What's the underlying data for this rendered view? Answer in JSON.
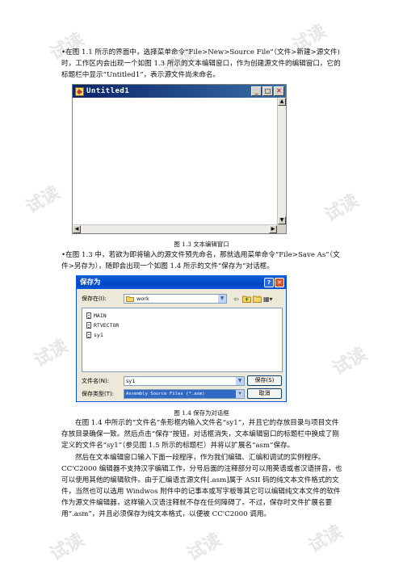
{
  "paragraphs": {
    "p1": "•在图 1.1 所示的界面中，选择菜单命令“File>New>Source File”（文件>新建>源文件)时，工作区内会出现一个如图 1.3 所示的文本编辑窗口，作为创建源文件的编辑窗口，它的标题栏中显示“Untitled1”，表示源文件尚未命名。",
    "p2": "•在图 1.3 中，若欲为即将输入的源文件预先命名，那就选用菜单命令“File>Save As”（文件>另存为），随即会出现一个如图 1.4 所示的文件“保存为”对话框。",
    "p3": "在图 1.4 中所示的“文件名”条形框内输入文件名“sy1”，并且它的存放目录与项目文件存放目录确保一致。然后点击“保存”按钮，对话框消失，文本编辑窗口的标题栏中换成了刚定义的文件名“sy1”（参见图 1.5 所示的标题栏）并将以扩展名“asm”保存。",
    "p4": "然后在文本编辑窗口输入下面一段程序，作为我们编辑、汇编和调试的实例程序。CC'C2000 编辑器不支持汉字编辑工作，分号后面的注释部分可以用英语或者汉语拼音，也可以使用其他的编辑软件。由于汇编语言源文件[.asm]属于 ASII 码的纯文本文件格式的文件，当然也可以选用 Windwos 附件中的记事本或写字板等其它可以编辑纯文本文件的软件作为源文件编辑器，这样输入汉语注释就不存在任何障碍了。不过，保存时文件扩展名要用“.asm”，并且必须保存为纯文本格式，以便被 CC'C2000 调用。"
  },
  "figure1": {
    "caption": "图 1.3    文本编辑窗口",
    "window_title": "Untitled1",
    "title_bar_color": "#0a246a"
  },
  "figure2": {
    "caption": "图 1.4    保存为对话框",
    "dialog_title": "保存为",
    "save_in_label": "保存在(I):",
    "save_in_value": "work",
    "files": [
      "MAIN",
      "RTVECTOR",
      "sy1"
    ],
    "filename_label": "文件名(N):",
    "filename_value": "sy1",
    "filetype_label": "保存类型(T):",
    "filetype_value": "Assembly Source Files (*.asm)",
    "save_button": "保存(S)",
    "cancel_button": "取消",
    "title_bar_color": "#0346c4"
  },
  "watermark_text": "试读"
}
